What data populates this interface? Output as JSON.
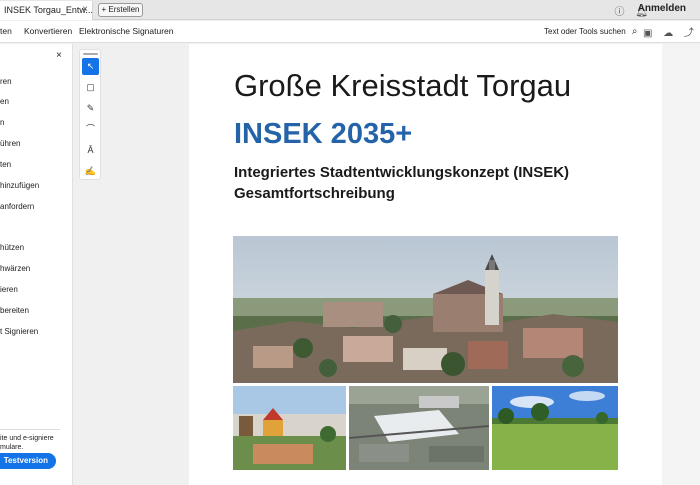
{
  "tabs": {
    "active_label": "INSEK Torgau_Entw...",
    "close": "×",
    "new_label": "+ Erstellen"
  },
  "header": {
    "login": "Anmelden"
  },
  "menu": {
    "items": [
      "ten",
      "Konvertieren",
      "Elektronische Signaturen"
    ],
    "search": "Text oder Tools suchen"
  },
  "sidebar": {
    "close": "×",
    "items": [
      "ren",
      "en",
      "n",
      "ühren",
      "ten",
      "hinzufügen",
      "anfordern",
      "hützen",
      "hwärzen",
      "ieren",
      "bereiten",
      "t Signieren"
    ],
    "promo_line1": "ite und e-signiere",
    "promo_line2": "mulare.",
    "trial": "Testversion"
  },
  "document": {
    "title": "Große Kreisstadt Torgau",
    "subtitle": "INSEK 2035+",
    "line1": "Integriertes Stadtentwicklungskonzept (INSEK)",
    "line2": "Gesamtfortschreibung"
  },
  "colors": {
    "accent": "#1473e6",
    "title_blue": "#2463a8"
  }
}
